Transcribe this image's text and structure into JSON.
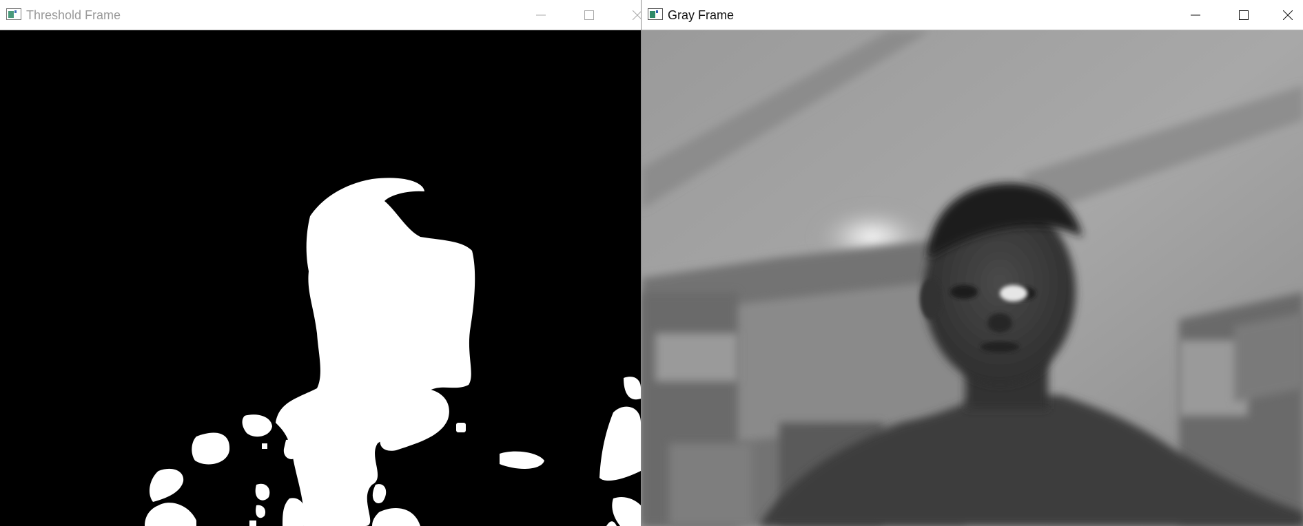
{
  "windows": [
    {
      "title": "Threshold Frame",
      "state": "inactive",
      "controls": [
        "minimize-icon",
        "maximize-icon",
        "close-icon"
      ],
      "content": "binary-threshold-image"
    },
    {
      "title": "Gray Frame",
      "state": "active",
      "controls": [
        "minimize-icon",
        "maximize-icon",
        "close-icon"
      ],
      "content": "grayscale-camera-image"
    }
  ],
  "colors": {
    "titlebar_bg": "#ffffff",
    "inactive_title": "#9a9a9a",
    "active_title": "#111111",
    "threshold_bg": "#000000",
    "threshold_fg": "#ffffff"
  }
}
